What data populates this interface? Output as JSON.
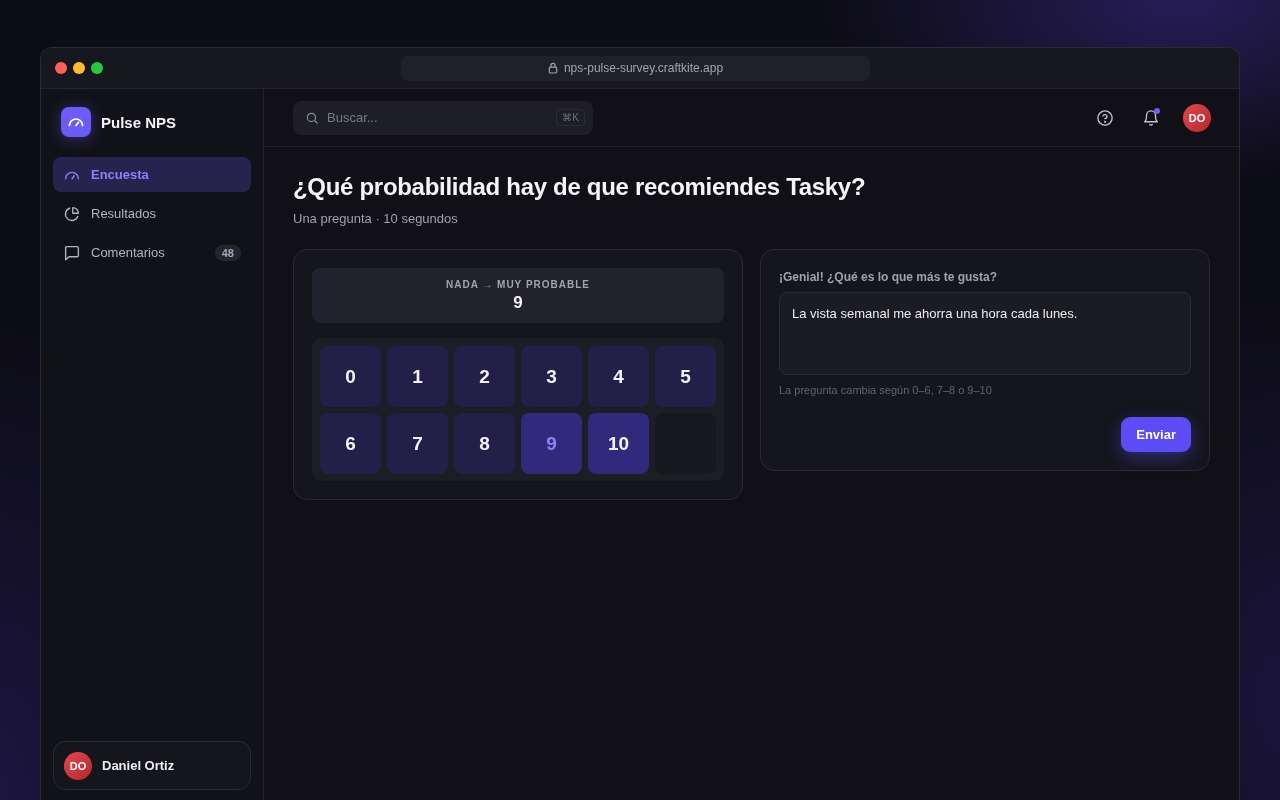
{
  "browser": {
    "url": "nps-pulse-survey.craftkite.app"
  },
  "sidebar": {
    "app_name": "Pulse NPS",
    "items": [
      {
        "label": "Encuesta",
        "selected": true
      },
      {
        "label": "Resultados",
        "selected": false
      },
      {
        "label": "Comentarios",
        "selected": false,
        "badge": "48"
      }
    ],
    "user": {
      "initials": "DO",
      "name": "Daniel Ortiz"
    }
  },
  "topbar": {
    "search": {
      "placeholder": "Buscar...",
      "shortcut": "⌘K"
    },
    "notifications": {
      "unread": true
    },
    "avatar_initials": "DO"
  },
  "survey": {
    "title": "¿Qué probabilidad hay de que recomiendes Tasky?",
    "subtitle": "Una pregunta · 10 segundos",
    "scale_label": "NADA → MUY PROBABLE",
    "score_value": "9",
    "scores": [
      {
        "label": "0",
        "selected": false,
        "highlighted": false
      },
      {
        "label": "1",
        "selected": false,
        "highlighted": false
      },
      {
        "label": "2",
        "selected": false,
        "highlighted": false
      },
      {
        "label": "3",
        "selected": false,
        "highlighted": false
      },
      {
        "label": "4",
        "selected": false,
        "highlighted": false
      },
      {
        "label": "5",
        "selected": false,
        "highlighted": false
      },
      {
        "label": "6",
        "selected": false,
        "highlighted": false
      },
      {
        "label": "7",
        "selected": false,
        "highlighted": false
      },
      {
        "label": "8",
        "selected": false,
        "highlighted": false
      },
      {
        "label": "9",
        "selected": true,
        "highlighted": true
      },
      {
        "label": "10",
        "selected": false,
        "highlighted": true
      }
    ],
    "followup": {
      "question": "¡Genial! ¿Qué es lo que más te gusta?",
      "answer": "La vista semanal me ahorra una hora cada lunes.",
      "hint": "La pregunta cambia según 0–6, 7–8 o 9–10",
      "submit": "Enviar"
    }
  }
}
